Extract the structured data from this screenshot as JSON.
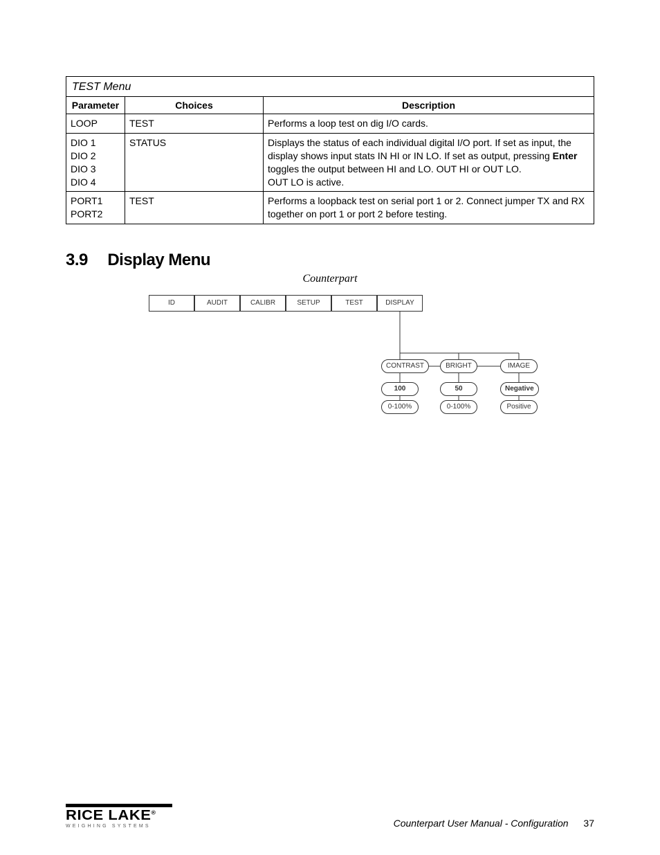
{
  "table": {
    "caption": "TEST Menu",
    "headers": {
      "param": "Parameter",
      "choices": "Choices",
      "desc": "Description"
    },
    "rows": [
      {
        "param": "LOOP",
        "choices": "TEST",
        "desc": "Performs a loop test on dig I/O cards."
      },
      {
        "param": "DIO 1\nDIO 2\nDIO 3\nDIO 4",
        "choices": "STATUS",
        "desc_pre": "Displays the status of each individual digital I/O port. If set as input, the display shows input stats IN HI or IN LO. If set as output, pressing ",
        "desc_bold": "Enter",
        "desc_post": " toggles the output between HI and LO. OUT HI or OUT LO.\nOUT LO is active."
      },
      {
        "param": "PORT1\nPORT2",
        "choices": "TEST",
        "desc": "Performs a loopback test on serial port 1 or 2. Connect jumper TX and RX together on port 1 or port 2 before testing."
      }
    ]
  },
  "section": {
    "num": "3.9",
    "title": "Display Menu",
    "subtitle": "Counterpart"
  },
  "menus": [
    "ID",
    "AUDIT",
    "CALIBR",
    "SETUP",
    "TEST",
    "DISPLAY"
  ],
  "sub": {
    "contrast": {
      "label": "CONTRAST",
      "value": "100",
      "range": "0-100%"
    },
    "bright": {
      "label": "BRIGHT",
      "value": "50",
      "range": "0-100%"
    },
    "image": {
      "label": "IMAGE",
      "v1": "Negative",
      "v2": "Positive"
    }
  },
  "footer": {
    "brand": "RICE LAKE",
    "tag": "WEIGHING SYSTEMS",
    "doc": "Counterpart User Manual - Configuration",
    "page": "37"
  }
}
